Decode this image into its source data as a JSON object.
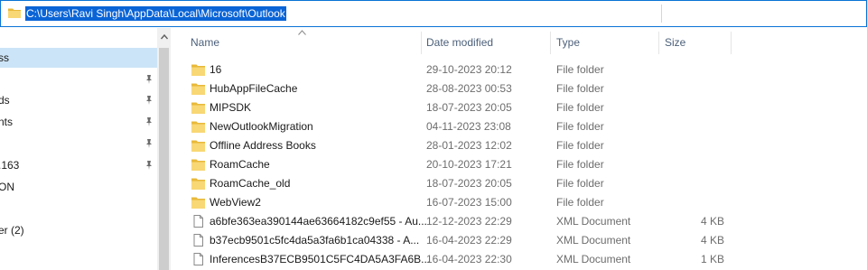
{
  "address_bar": {
    "path": "C:\\Users\\Ravi Singh\\AppData\\Local\\Microsoft\\Outlook",
    "icon": "folder-icon"
  },
  "nav": {
    "items": [
      {
        "label": "ss",
        "selected": true,
        "pinned": false
      },
      {
        "label": "",
        "pinned": true
      },
      {
        "label": "ds",
        "pinned": true
      },
      {
        "label": "nts",
        "pinned": true
      },
      {
        "label": "",
        "pinned": true
      },
      {
        "label": ".163",
        "pinned": true
      },
      {
        "label": "ON",
        "pinned": false
      },
      {
        "label": "",
        "pinned": false
      },
      {
        "label": "er (2)",
        "pinned": false
      }
    ]
  },
  "columns": {
    "name": "Name",
    "date": "Date modified",
    "type": "Type",
    "size": "Size"
  },
  "files": [
    {
      "name": "16",
      "date": "29-10-2023 20:12",
      "type": "File folder",
      "size": "",
      "icon": "folder-icon"
    },
    {
      "name": "HubAppFileCache",
      "date": "28-08-2023 00:53",
      "type": "File folder",
      "size": "",
      "icon": "folder-icon"
    },
    {
      "name": "MIPSDK",
      "date": "18-07-2023 20:05",
      "type": "File folder",
      "size": "",
      "icon": "folder-icon"
    },
    {
      "name": "NewOutlookMigration",
      "date": "04-11-2023 23:08",
      "type": "File folder",
      "size": "",
      "icon": "folder-icon"
    },
    {
      "name": "Offline Address Books",
      "date": "28-01-2023 12:02",
      "type": "File folder",
      "size": "",
      "icon": "folder-icon"
    },
    {
      "name": "RoamCache",
      "date": "20-10-2023 17:21",
      "type": "File folder",
      "size": "",
      "icon": "folder-icon"
    },
    {
      "name": "RoamCache_old",
      "date": "18-07-2023 20:05",
      "type": "File folder",
      "size": "",
      "icon": "folder-icon"
    },
    {
      "name": "WebView2",
      "date": "16-07-2023 15:00",
      "type": "File folder",
      "size": "",
      "icon": "folder-icon"
    },
    {
      "name": "a6bfe363ea390144ae63664182c9ef55 - Au...",
      "date": "12-12-2023 22:29",
      "type": "XML Document",
      "size": "4 KB",
      "icon": "document-icon"
    },
    {
      "name": "b37ecb9501c5fc4da5a3fa6b1ca04338 - A...",
      "date": "16-04-2023 22:29",
      "type": "XML Document",
      "size": "4 KB",
      "icon": "document-icon"
    },
    {
      "name": "InferencesB37ECB9501C5FC4DA5A3FA6B...",
      "date": "16-04-2023 22:30",
      "type": "XML Document",
      "size": "1 KB",
      "icon": "document-icon"
    }
  ],
  "colors": {
    "accent": "#0a64d6",
    "selection": "#cce4f7",
    "folder": "#f8d775"
  }
}
